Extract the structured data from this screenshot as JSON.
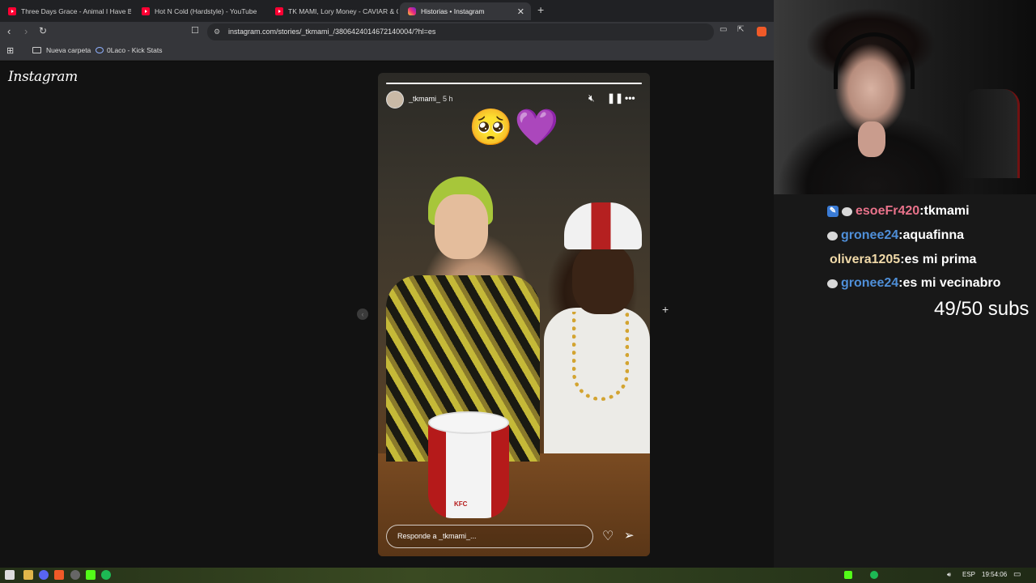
{
  "browser": {
    "tabs": [
      {
        "label": "Three Days Grace - Animal I Have Be",
        "icon": "youtube-icon",
        "active": false
      },
      {
        "label": "Hot N Cold (Hardstyle) - YouTube",
        "icon": "youtube-icon",
        "active": false
      },
      {
        "label": "TK MAMI, Lory Money - CAVIAR & C",
        "icon": "youtube-icon",
        "active": false
      },
      {
        "label": "Historias • Instagram",
        "icon": "instagram-icon",
        "active": true
      }
    ],
    "url": "instagram.com/stories/_tkmami_/3806424014672140004/?hl=es",
    "bookmarks": [
      "Nueva carpeta",
      "0Laco - Kick Stats"
    ]
  },
  "instagram": {
    "logo": "Instagram",
    "story": {
      "username": "_tkmami_",
      "time": "5 h",
      "emojis": "🥺💜",
      "progress": 1.0,
      "reply_placeholder": "Responde a _tkmami_..."
    }
  },
  "chat": {
    "messages": [
      {
        "user": "esoeFr420",
        "text": "tkmami",
        "color": "#e8728a",
        "badges": [
          "sub-badge",
          "bot-badge"
        ]
      },
      {
        "user": "gronee24",
        "text": "aquafinna",
        "color": "#4f8fd8",
        "badges": [
          "bot-badge"
        ]
      },
      {
        "user": "olivera1205",
        "text": "es mi prima",
        "color": "#f0d9a8",
        "badges": []
      },
      {
        "user": "gronee24",
        "text": "es mi vecinabro",
        "color": "#4f8fd8",
        "badges": [
          "bot-badge"
        ]
      }
    ],
    "separator": " : ",
    "subs": "49/50 subs"
  },
  "taskbar": {
    "language": "ESP",
    "time": "19:54:06"
  }
}
